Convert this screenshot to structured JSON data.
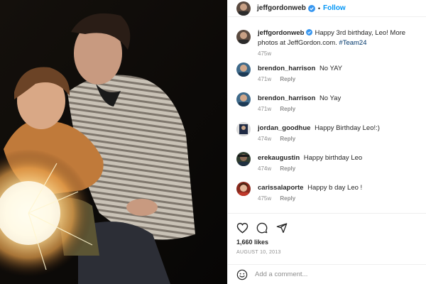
{
  "post": {
    "author": "jeffgordonweb",
    "follow_label": "Follow",
    "separator": "•",
    "caption": {
      "username": "jeffgordonweb",
      "text": "Happy 3rd birthday, Leo! More photos at JeffGordon.com.",
      "hashtag": "#Team24",
      "age": "475w"
    },
    "likes": "1,660 likes",
    "date": "AUGUST 10, 2013"
  },
  "comments": [
    {
      "username": "brendon_harrison",
      "text": "No YAY",
      "age": "471w",
      "reply_label": "Reply"
    },
    {
      "username": "brendon_harrison",
      "text": "No Yay",
      "age": "471w",
      "reply_label": "Reply"
    },
    {
      "username": "jordan_goodhue",
      "text": "Happy Birthday Leo!:)",
      "age": "474w",
      "reply_label": "Reply"
    },
    {
      "username": "erekaugustin",
      "text": "Happy birthday Leo",
      "age": "474w",
      "reply_label": "Reply"
    },
    {
      "username": "carissalaporte",
      "text": "Happy b day Leo !",
      "age": "475w",
      "reply_label": "Reply"
    }
  ],
  "add_comment": {
    "placeholder": "Add a comment..."
  },
  "icons": {
    "like": "heart-icon",
    "comment": "comment-icon",
    "share": "share-icon",
    "emoji": "emoji-icon",
    "verified": "verified-badge-icon"
  },
  "colors": {
    "accent": "#0095f6",
    "hashtag": "#00376b",
    "muted": "#8e8e8e",
    "verified": "#3897f0"
  }
}
